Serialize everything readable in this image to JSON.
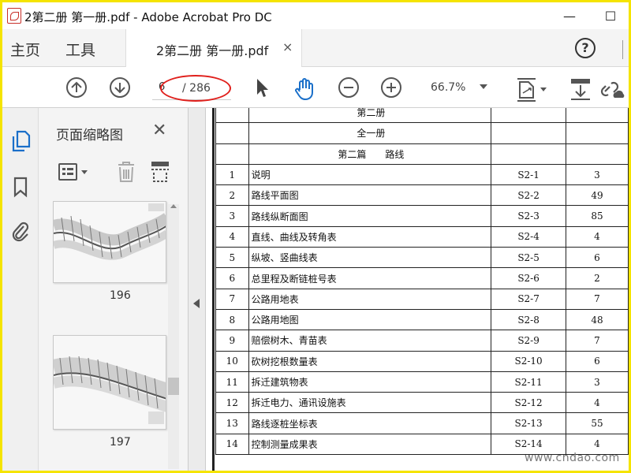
{
  "window": {
    "title": "2第二册 第一册.pdf - Adobe Acrobat Pro DC",
    "minimize": "—",
    "maximize": "☐"
  },
  "tabs": {
    "home": "主页",
    "tools": "工具",
    "document": "2第二册 第一册.pdf",
    "close": "×",
    "help": "?"
  },
  "toolbar": {
    "page_current": "6",
    "page_total": "/ 286",
    "zoom": "66.7%"
  },
  "thumbnail_panel": {
    "title": "页面缩略图",
    "close": "✕",
    "thumbnails": [
      {
        "page": "196"
      },
      {
        "page": "197"
      }
    ]
  },
  "document": {
    "header_rows": [
      "第二册",
      "全一册",
      "第二篇　　路线"
    ],
    "rows": [
      {
        "num": "1",
        "name": "说明",
        "code": "S2-1",
        "pages": "3"
      },
      {
        "num": "2",
        "name": "路线平面图",
        "code": "S2-2",
        "pages": "49"
      },
      {
        "num": "3",
        "name": "路线纵断面图",
        "code": "S2-3",
        "pages": "85"
      },
      {
        "num": "4",
        "name": "直线、曲线及转角表",
        "code": "S2-4",
        "pages": "4"
      },
      {
        "num": "5",
        "name": "纵坡、竖曲线表",
        "code": "S2-5",
        "pages": "6"
      },
      {
        "num": "6",
        "name": "总里程及断链桩号表",
        "code": "S2-6",
        "pages": "2"
      },
      {
        "num": "7",
        "name": "公路用地表",
        "code": "S2-7",
        "pages": "7"
      },
      {
        "num": "8",
        "name": "公路用地图",
        "code": "S2-8",
        "pages": "48"
      },
      {
        "num": "9",
        "name": "赔偿树木、青苗表",
        "code": "S2-9",
        "pages": "7"
      },
      {
        "num": "10",
        "name": "砍树挖根数量表",
        "code": "S2-10",
        "pages": "6"
      },
      {
        "num": "11",
        "name": "拆迁建筑物表",
        "code": "S2-11",
        "pages": "3"
      },
      {
        "num": "12",
        "name": "拆迁电力、通讯设施表",
        "code": "S2-12",
        "pages": "4"
      },
      {
        "num": "13",
        "name": "路线逐桩坐标表",
        "code": "S2-13",
        "pages": "55"
      },
      {
        "num": "14",
        "name": "控制测量成果表",
        "code": "S2-14",
        "pages": "4"
      }
    ]
  },
  "watermark": "www.cndao.com",
  "colors": {
    "annotation": "#e0201c",
    "frame": "#f5e400",
    "hand_tool": "#1a6fc9"
  }
}
